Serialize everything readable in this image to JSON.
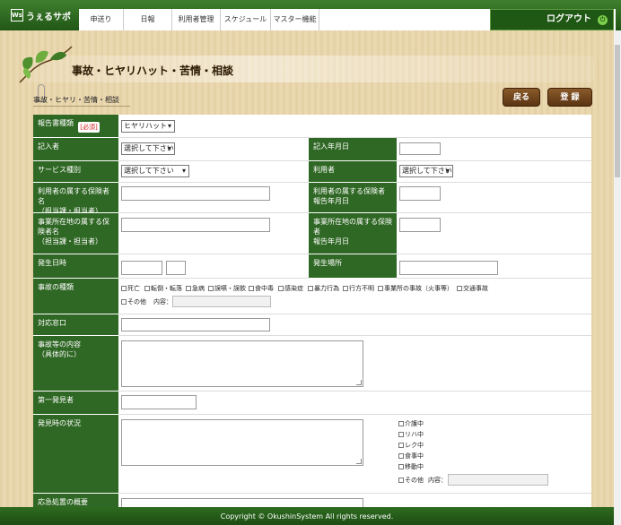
{
  "app": {
    "logo_mark": "Ws",
    "logo_text": "うぇるサポ"
  },
  "nav": {
    "items": [
      "申送り",
      "日報",
      "利用者管理",
      "スケジュール",
      "マスター機能"
    ],
    "logout": "ログアウト"
  },
  "page": {
    "title": "事故・ヒヤリハット・苦情・相談",
    "breadcrumb": "事故・ヒヤリ・苦情・相談",
    "back": "戻る",
    "register": "登 録"
  },
  "form": {
    "report_type": {
      "label": "報告書種類",
      "badge": "[必須]",
      "value": "ヒヤリハット"
    },
    "recorder": {
      "label": "記入者",
      "value": "選択して下さい"
    },
    "record_date": {
      "label": "記入年月日",
      "value": ""
    },
    "service_type": {
      "label": "サービス種別",
      "value": "選択して下さい"
    },
    "user": {
      "label": "利用者",
      "value": "選択して下さい"
    },
    "user_insurer": {
      "label": "利用者の属する保険者名\n（担当課・担当者）",
      "value": ""
    },
    "user_insurer_date": {
      "label": "利用者の属する保険者\n報告年月日",
      "value": ""
    },
    "office_insurer": {
      "label": "事業所在地の属する保険者名\n（担当課・担当者）",
      "value": ""
    },
    "office_insurer_date": {
      "label": "事業所在地の属する保険者\n報告年月日",
      "value": ""
    },
    "occurrence_date": {
      "label": "発生日時",
      "value": ""
    },
    "occurrence_place": {
      "label": "発生場所",
      "value": ""
    },
    "accident_type": {
      "label": "事故の種類",
      "options": [
        "死亡",
        "転倒・転落",
        "急病",
        "誤嚥・誤飲",
        "食中毒",
        "感染症",
        "暴力行為",
        "行方不明",
        "事業所の事故（火事等）",
        "交通事故"
      ],
      "other": "その他",
      "content_label": "内容："
    },
    "contact_window": {
      "label": "対応窓口",
      "value": ""
    },
    "accident_detail": {
      "label": "事故等の内容\n（具体的に）",
      "value": ""
    },
    "first_discoverer": {
      "label": "第一発見者",
      "value": ""
    },
    "discovery_situation": {
      "label": "発見時の状況",
      "options": [
        "介護中",
        "リハ中",
        "レク中",
        "食事中",
        "移動中"
      ],
      "other": "その他",
      "content_label": "内容："
    },
    "emergency_summary": {
      "label": "応急処置の概要"
    }
  },
  "footer": {
    "copyright": "Copyright © OkushinSystem All rights reserved."
  },
  "colors": {
    "header_green": "#2f6724",
    "button_brown": "#6e4119",
    "required_red": "#d51a1a"
  }
}
